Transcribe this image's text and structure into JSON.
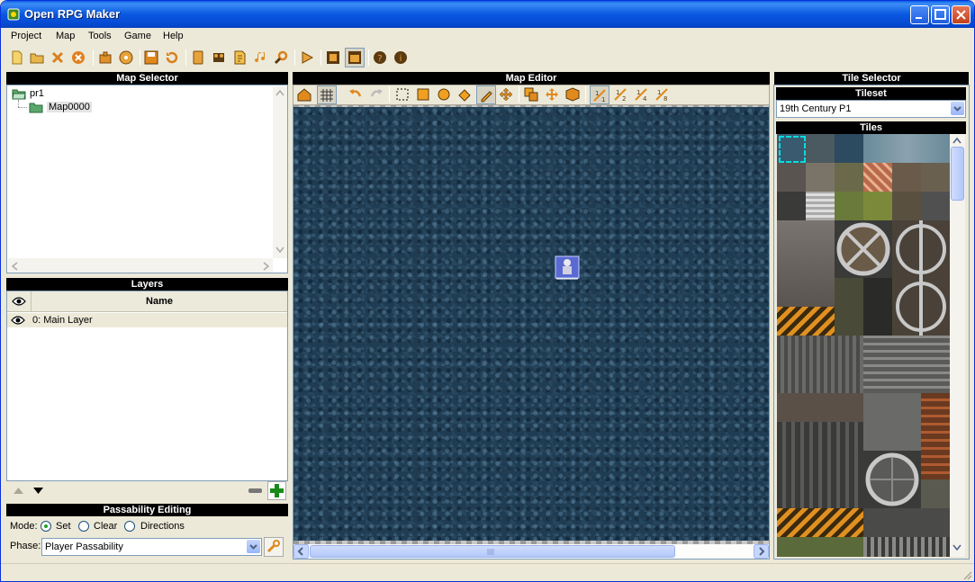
{
  "window": {
    "title": "Open RPG Maker"
  },
  "menu": [
    "Project",
    "Map",
    "Tools",
    "Game",
    "Help"
  ],
  "map_selector": {
    "header": "Map Selector",
    "tree": [
      {
        "label": "pr1"
      },
      {
        "label": "Map0000"
      }
    ]
  },
  "layers": {
    "header": "Layers",
    "column_name": "Name",
    "rows": [
      {
        "label": "0: Main Layer"
      }
    ]
  },
  "passability": {
    "header": "Passability Editing",
    "mode_label": "Mode:",
    "modes": [
      "Set",
      "Clear",
      "Directions"
    ],
    "selected_mode": "Set",
    "phase_label": "Phase:",
    "phase_value": "Player Passability"
  },
  "map_editor": {
    "header": "Map Editor"
  },
  "tile_selector": {
    "header": "Tile Selector",
    "tileset_header": "Tileset",
    "tileset_value": "19th Century P1",
    "tiles_header": "Tiles"
  },
  "colors": {
    "title_bar": "#0a58e0",
    "panel_header": "#000000",
    "map_water": "#1f3c52",
    "selection": "#00e0e0"
  }
}
